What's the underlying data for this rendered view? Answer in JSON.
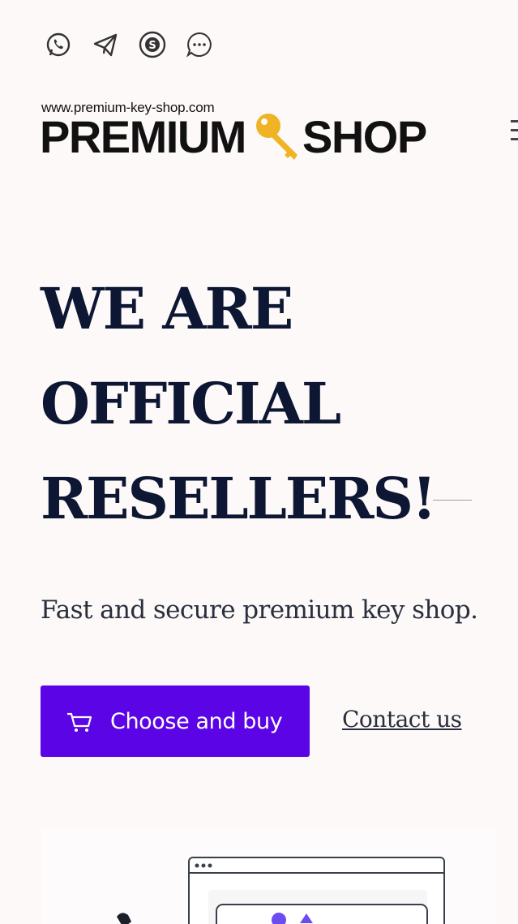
{
  "social_icons": [
    "whatsapp-icon",
    "telegram-icon",
    "skype-icon",
    "chat-icon"
  ],
  "logo": {
    "url": "www.premium-key-shop.com",
    "word_left": "PREMIUM",
    "word_right": "SHOP",
    "key_color": "#f0b324"
  },
  "hero": {
    "title_lines": [
      "WE ARE",
      "OFFICIAL",
      "RESELLERS!"
    ],
    "subtitle": "Fast and secure premium key shop."
  },
  "actions": {
    "buy_label": "Choose and buy",
    "contact_label": "Contact us"
  },
  "colors": {
    "accent": "#5b05e6",
    "heading": "#0d1632",
    "background": "#fcf9f8"
  }
}
